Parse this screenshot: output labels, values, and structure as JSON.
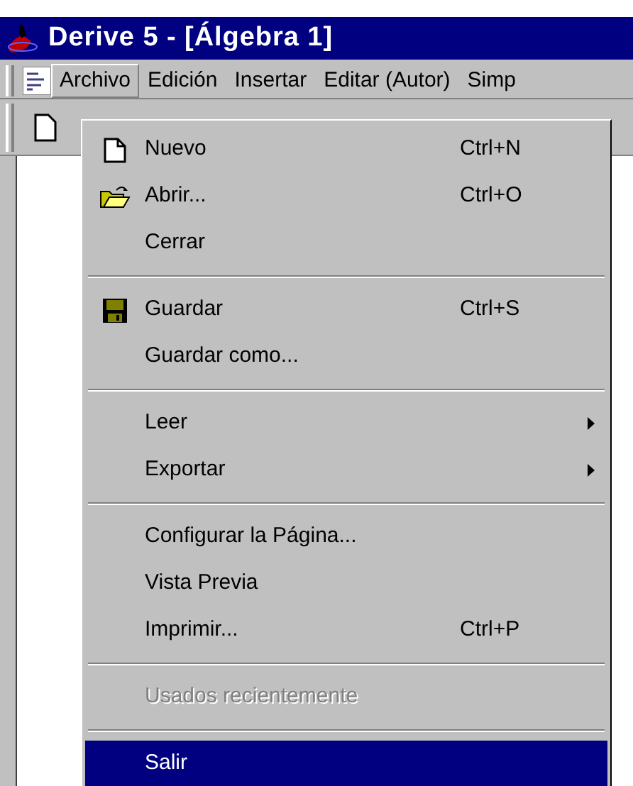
{
  "window": {
    "title": "Derive 5 - [Álgebra 1]"
  },
  "menubar": [
    {
      "label": "Archivo",
      "selected": true
    },
    {
      "label": "Edición",
      "selected": false
    },
    {
      "label": "Insertar",
      "selected": false
    },
    {
      "label": "Editar (Autor)",
      "selected": false
    },
    {
      "label": "Simp",
      "selected": false
    }
  ],
  "menu": [
    {
      "kind": "item",
      "label": "Nuevo",
      "shortcut": "Ctrl+N",
      "submenu": false,
      "disabled": false,
      "selected": false
    },
    {
      "kind": "item",
      "label": "Abrir...",
      "shortcut": "Ctrl+O",
      "submenu": false,
      "disabled": false,
      "selected": false
    },
    {
      "kind": "item",
      "label": "Cerrar",
      "submenu": false,
      "disabled": false,
      "selected": false
    },
    {
      "kind": "separator"
    },
    {
      "kind": "item",
      "label": "Guardar",
      "shortcut": "Ctrl+S",
      "submenu": false,
      "disabled": false,
      "selected": false
    },
    {
      "kind": "item",
      "label": "Guardar como...",
      "submenu": false,
      "disabled": false,
      "selected": false
    },
    {
      "kind": "separator"
    },
    {
      "kind": "item",
      "label": "Leer",
      "submenu": true,
      "disabled": false,
      "selected": false
    },
    {
      "kind": "item",
      "label": "Exportar",
      "submenu": true,
      "disabled": false,
      "selected": false
    },
    {
      "kind": "separator"
    },
    {
      "kind": "item",
      "label": "Configurar la Página...",
      "submenu": false,
      "disabled": false,
      "selected": false
    },
    {
      "kind": "item",
      "label": "Vista Previa",
      "submenu": false,
      "disabled": false,
      "selected": false
    },
    {
      "kind": "item",
      "label": "Imprimir...",
      "shortcut": "Ctrl+P",
      "submenu": false,
      "disabled": false,
      "selected": false
    },
    {
      "kind": "separator"
    },
    {
      "kind": "item",
      "label": "Usados recientemente",
      "submenu": false,
      "disabled": true,
      "selected": false
    },
    {
      "kind": "separator"
    },
    {
      "kind": "item",
      "label": "Salir",
      "submenu": false,
      "disabled": false,
      "selected": true
    }
  ]
}
